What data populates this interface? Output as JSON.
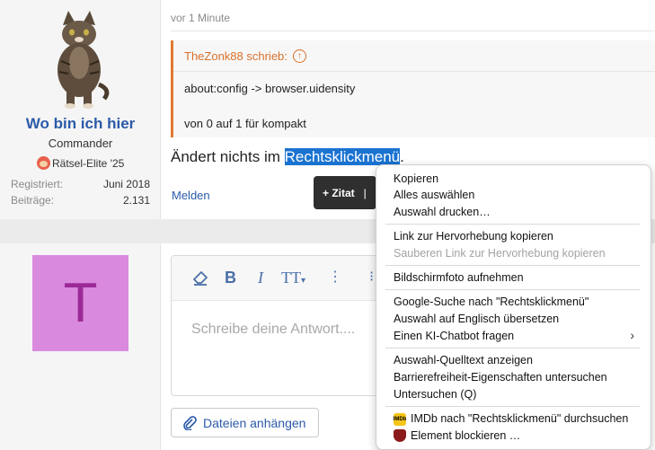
{
  "post1": {
    "username": "Wo bin ich hier",
    "rank": "Commander",
    "badge": "Rätsel-Elite '25",
    "stats": [
      {
        "label": "Registriert:",
        "value": "Juni 2018"
      },
      {
        "label": "Beiträge:",
        "value": "2.131"
      }
    ],
    "time": "vor 1 Minute",
    "quote_author": "TheZonk88 schrieb:",
    "quote_line1": "about:config -> browser.uidensity",
    "quote_line2": "von 0 auf 1 für kompakt",
    "message_before": "Ändert nichts im ",
    "message_selected": "Rechtsklickmenü",
    "message_after": ".",
    "report_label": "Melden",
    "quote_button": "+ Zitat",
    "quote_button_sep": "|"
  },
  "reply": {
    "avatar_letter": "T",
    "placeholder": "Schreibe deine Antwort....",
    "attach_label": "Dateien anhängen",
    "toolbar": {
      "bold": "B",
      "italic": "I",
      "text_size": "TT",
      "more": "⋮"
    }
  },
  "context_menu": {
    "items": [
      {
        "label": "Kopieren",
        "disabled": false
      },
      {
        "label": "Alles auswählen",
        "disabled": false
      },
      {
        "label": "Auswahl drucken…",
        "disabled": false
      },
      {
        "label": "Link zur Hervorhebung kopieren",
        "disabled": false
      },
      {
        "label": "Sauberen Link zur Hervorhebung kopieren",
        "disabled": true
      },
      {
        "label": "Bildschirmfoto aufnehmen",
        "disabled": false
      },
      {
        "label": "Google-Suche nach \"Rechtsklickmenü\"",
        "disabled": false
      },
      {
        "label": "Auswahl auf Englisch übersetzen",
        "disabled": false
      },
      {
        "label": "Einen KI-Chatbot fragen",
        "disabled": false
      },
      {
        "label": "Auswahl-Quelltext anzeigen",
        "disabled": false
      },
      {
        "label": "Barrierefreiheit-Eigenschaften untersuchen",
        "disabled": false
      },
      {
        "label": "Untersuchen (Q)",
        "disabled": false
      },
      {
        "label": "IMDb nach \"Rechtsklickmenü\" durchsuchen",
        "disabled": false
      },
      {
        "label": "Element blockieren …",
        "disabled": false
      }
    ],
    "imdb_icon_text": "IMDb"
  },
  "colors": {
    "link": "#2b5aa8",
    "quote_accent": "#e07a2f",
    "selection": "#1a73d1",
    "avatar_bg": "#d98ade",
    "avatar_letter": "#9b2a97"
  }
}
